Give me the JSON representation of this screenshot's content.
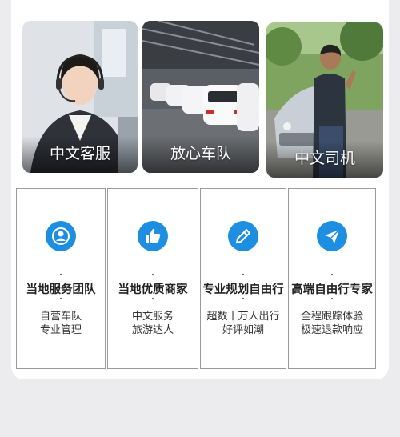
{
  "photos": [
    {
      "label": "中文客服"
    },
    {
      "label": "放心车队"
    },
    {
      "label": "中文司机"
    }
  ],
  "features": [
    {
      "icon": "user-icon",
      "title": "当地服务团队",
      "line1": "自营车队",
      "line2": "专业管理"
    },
    {
      "icon": "thumbs-up-icon",
      "title": "当地优质商家",
      "line1": "中文服务",
      "line2": "旅游达人"
    },
    {
      "icon": "pencil-icon",
      "title": "专业规划自由行",
      "line1": "超数十万人出行",
      "line2": "好评如潮"
    },
    {
      "icon": "paper-plane-icon",
      "title": "高端自由行专家",
      "line1": "全程跟踪体验",
      "line2": "极速退款响应"
    }
  ],
  "colors": {
    "icon_blue": "#1e8fe0",
    "background": "#ececee"
  }
}
